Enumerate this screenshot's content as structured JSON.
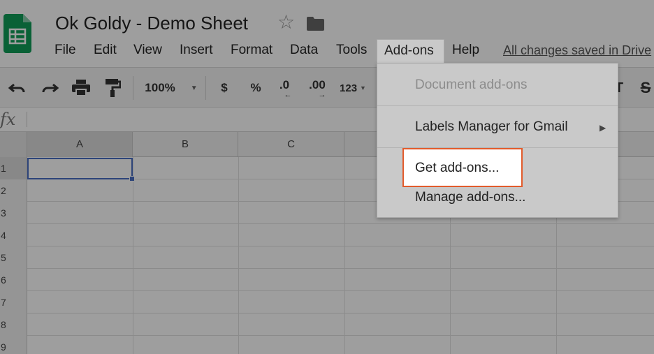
{
  "app": {
    "title": "Ok Goldy - Demo Sheet",
    "saved_status": "All changes saved in Drive"
  },
  "menubar": {
    "items": [
      {
        "label": "File"
      },
      {
        "label": "Edit"
      },
      {
        "label": "View"
      },
      {
        "label": "Insert"
      },
      {
        "label": "Format"
      },
      {
        "label": "Data"
      },
      {
        "label": "Tools"
      },
      {
        "label": "Add-ons"
      },
      {
        "label": "Help"
      }
    ],
    "active": "Add-ons"
  },
  "toolbar": {
    "zoom": "100%",
    "currency": "$",
    "percent": "%",
    "decrease_decimal": ".0",
    "increase_decimal": ".00",
    "number_format": "123"
  },
  "formula_bar": {
    "label": "fx",
    "value": ""
  },
  "grid": {
    "columns": [
      "A",
      "B",
      "C"
    ],
    "rows": [
      "1",
      "2",
      "3",
      "4",
      "5",
      "6",
      "7",
      "8",
      "9"
    ],
    "selected_cell": "A1"
  },
  "addons_menu": {
    "items": [
      {
        "label": "Document add-ons",
        "disabled": true
      },
      {
        "label": "Labels Manager for Gmail",
        "submenu": true
      },
      {
        "label": "Get add-ons...",
        "highlighted": true
      },
      {
        "label": "Manage add-ons..."
      }
    ],
    "highlight_color": "#e25b2b"
  },
  "colors": {
    "sheets_green": "#0f9d58",
    "selection_blue": "#4a6fc4"
  },
  "icons": [
    "sheets-logo-icon",
    "star-icon",
    "folder-icon",
    "undo-icon",
    "redo-icon",
    "print-icon",
    "paint-format-icon",
    "chevron-down-icon",
    "submenu-arrow-icon"
  ]
}
